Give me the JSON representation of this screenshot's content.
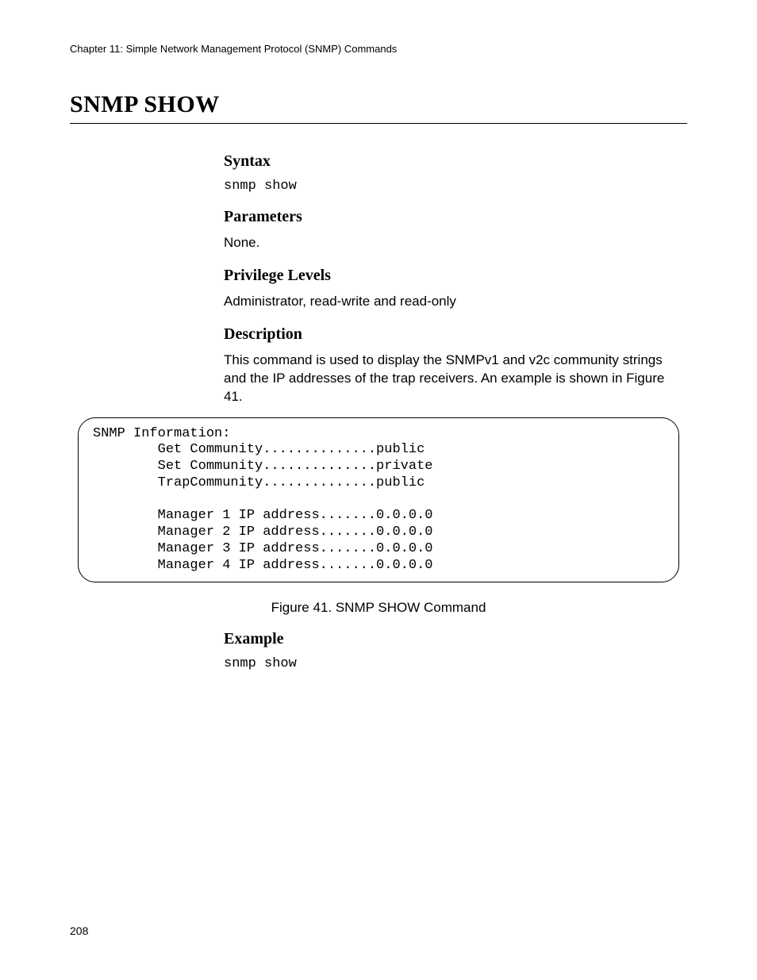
{
  "header": {
    "running": "Chapter 11: Simple Network Management Protocol (SNMP) Commands"
  },
  "title": "SNMP SHOW",
  "sections": {
    "syntax": {
      "heading": "Syntax",
      "code": "snmp show"
    },
    "parameters": {
      "heading": "Parameters",
      "text": "None."
    },
    "privilege": {
      "heading": "Privilege Levels",
      "text": "Administrator, read-write and read-only"
    },
    "description": {
      "heading": "Description",
      "text": "This command is used to display the SNMPv1 and v2c community strings and the IP addresses of the trap receivers. An example is shown in Figure 41."
    },
    "figure": {
      "content": "SNMP Information:\n        Get Community..............public\n        Set Community..............private\n        TrapCommunity..............public\n\n        Manager 1 IP address.......0.0.0.0\n        Manager 2 IP address.......0.0.0.0\n        Manager 3 IP address.......0.0.0.0\n        Manager 4 IP address.......0.0.0.0",
      "caption": "Figure 41. SNMP SHOW Command"
    },
    "example": {
      "heading": "Example",
      "code": "snmp show"
    }
  },
  "page_number": "208"
}
